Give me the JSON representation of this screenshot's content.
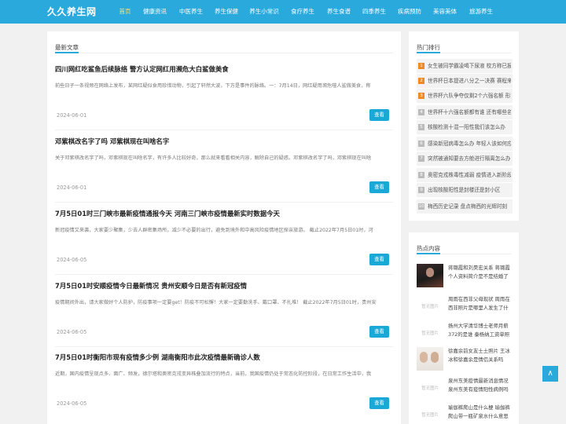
{
  "header": {
    "logo": "久久养生网",
    "nav": [
      {
        "label": "首页",
        "active": true
      },
      {
        "label": "健康资讯"
      },
      {
        "label": "中医养生"
      },
      {
        "label": "养生保健"
      },
      {
        "label": "养生小常识"
      },
      {
        "label": "食疗养生"
      },
      {
        "label": "养生食谱"
      },
      {
        "label": "四季养生"
      },
      {
        "label": "疾病预防"
      },
      {
        "label": "美容美体"
      },
      {
        "label": "旅游养生"
      }
    ]
  },
  "main": {
    "title": "最新文章",
    "read_label": "查看",
    "articles": [
      {
        "title": "四川网红吃鲨鱼后续脉络 警方认定网红用濒危大白鲨做美食",
        "summary": "前些日子一条视频在网络上发布，某网红疑似食用珍惜动物，引起了轩然大波，下方是事件的脉络。一：7月14日，网红疑用濒危噬人鲨做美食，称",
        "date": "2024-06-01"
      },
      {
        "title": "邓紫棋改名字了吗 邓紫棋现在叫啥名字",
        "summary": "关于邓紫棋改名字了吗，邓紫棋现在叫啥名字，有许多人比较好奇，那么就来看看相关内容，解除自己的疑惑。邓紫棋改名字了吗，邓紫棋现在叫啥",
        "date": "2024-06-01"
      },
      {
        "title": "7月5日01时三门峡市最新疫情通报今天 河南三门峡市疫情最新实时数据今天",
        "summary": "新冠疫情又来袭，大家要少聚集，少去人群密集场所，减少不必要的出行，避免到境外和中高风险疫情地区探亲旅游。 截止2022年7月5日01时，河",
        "date": "2024-06-05"
      },
      {
        "title": "7月5日01时安顺疫情今日最新情况 贵州安顺今日是否有新冠疫情",
        "summary": "疫情期间外出，请大家做好个人防护，防疫事项一定要get！防疫不可松懈！大家一定要勤洗手、戴口罩、不扎堆！ 截止2022年7月5日01时，贵州安",
        "date": "2024-06-05"
      },
      {
        "title": "7月5日01时衡阳市现有疫情多少例 湖南衡阳市此次疫情最新确诊人数",
        "summary": "近期，国内疫情呈现点多、面广、频发，德尔塔和奥密克戎变异株叠加流行的特点，当前，我国疫情仍处于常态化防控阶段，在日常工作生活中，我",
        "date": "2024-06-05"
      }
    ]
  },
  "sidebar": {
    "ranking": {
      "title": "热门排行",
      "items": [
        {
          "num": "1",
          "text": "女生被同学霸凌喝下尿液 校方称已报警处理"
        },
        {
          "num": "2",
          "text": "世界杯日本提进八分之一决赛 赛程来了"
        },
        {
          "num": "3",
          "text": "世界杯六队争夺仅剩2个六强名额 形势如何"
        },
        {
          "num": "4",
          "text": "世界杯十六强名额都有谁 还有哪些名额"
        },
        {
          "num": "5",
          "text": "核酸检测十混一阳性我们该怎么办"
        },
        {
          "num": "6",
          "text": "感染新冠病毒怎么办 年轻人该如何应对"
        },
        {
          "num": "7",
          "text": "突然被通知要去方舱进行隔离怎么办"
        },
        {
          "num": "8",
          "text": "奥密克戎株毒性减弱 疫情进入新阶段"
        },
        {
          "num": "9",
          "text": "出现核酸阳性是封楼还是封小区"
        },
        {
          "num": "10",
          "text": "梅西历史记录 盘点梅西的光辉时刻"
        }
      ]
    },
    "hot": {
      "title": "热点内容",
      "placeholder": "暂无图片",
      "items": [
        {
          "text": "蒋璐霞和刘昊宏关系 蒋璐霞个人资料简介是不是结婚了",
          "thumb": "photo-dark"
        },
        {
          "text": "周雨在西非父母现状 周雨在西非照片是哪里人发生了什么",
          "thumb": "placeholder"
        },
        {
          "text": "扬州大学清华博士老师月薪372的是谁 秦杨纳工资单照片",
          "thumb": "placeholder"
        },
        {
          "text": "徐嘉余前女友士土照片 王冰冰和徐嘉余是情侣关系吗",
          "thumb": "photo-light"
        },
        {
          "text": "泉州东美疫情最新消息情况 泉州东美有疫情阳性病例吗",
          "thumb": "placeholder"
        },
        {
          "text": "瑜伽裤爬山是什么梗 瑜伽裤爬山带一瓶矿泉水什么意思",
          "thumb": "placeholder"
        }
      ]
    }
  },
  "back_to_top": "∧"
}
